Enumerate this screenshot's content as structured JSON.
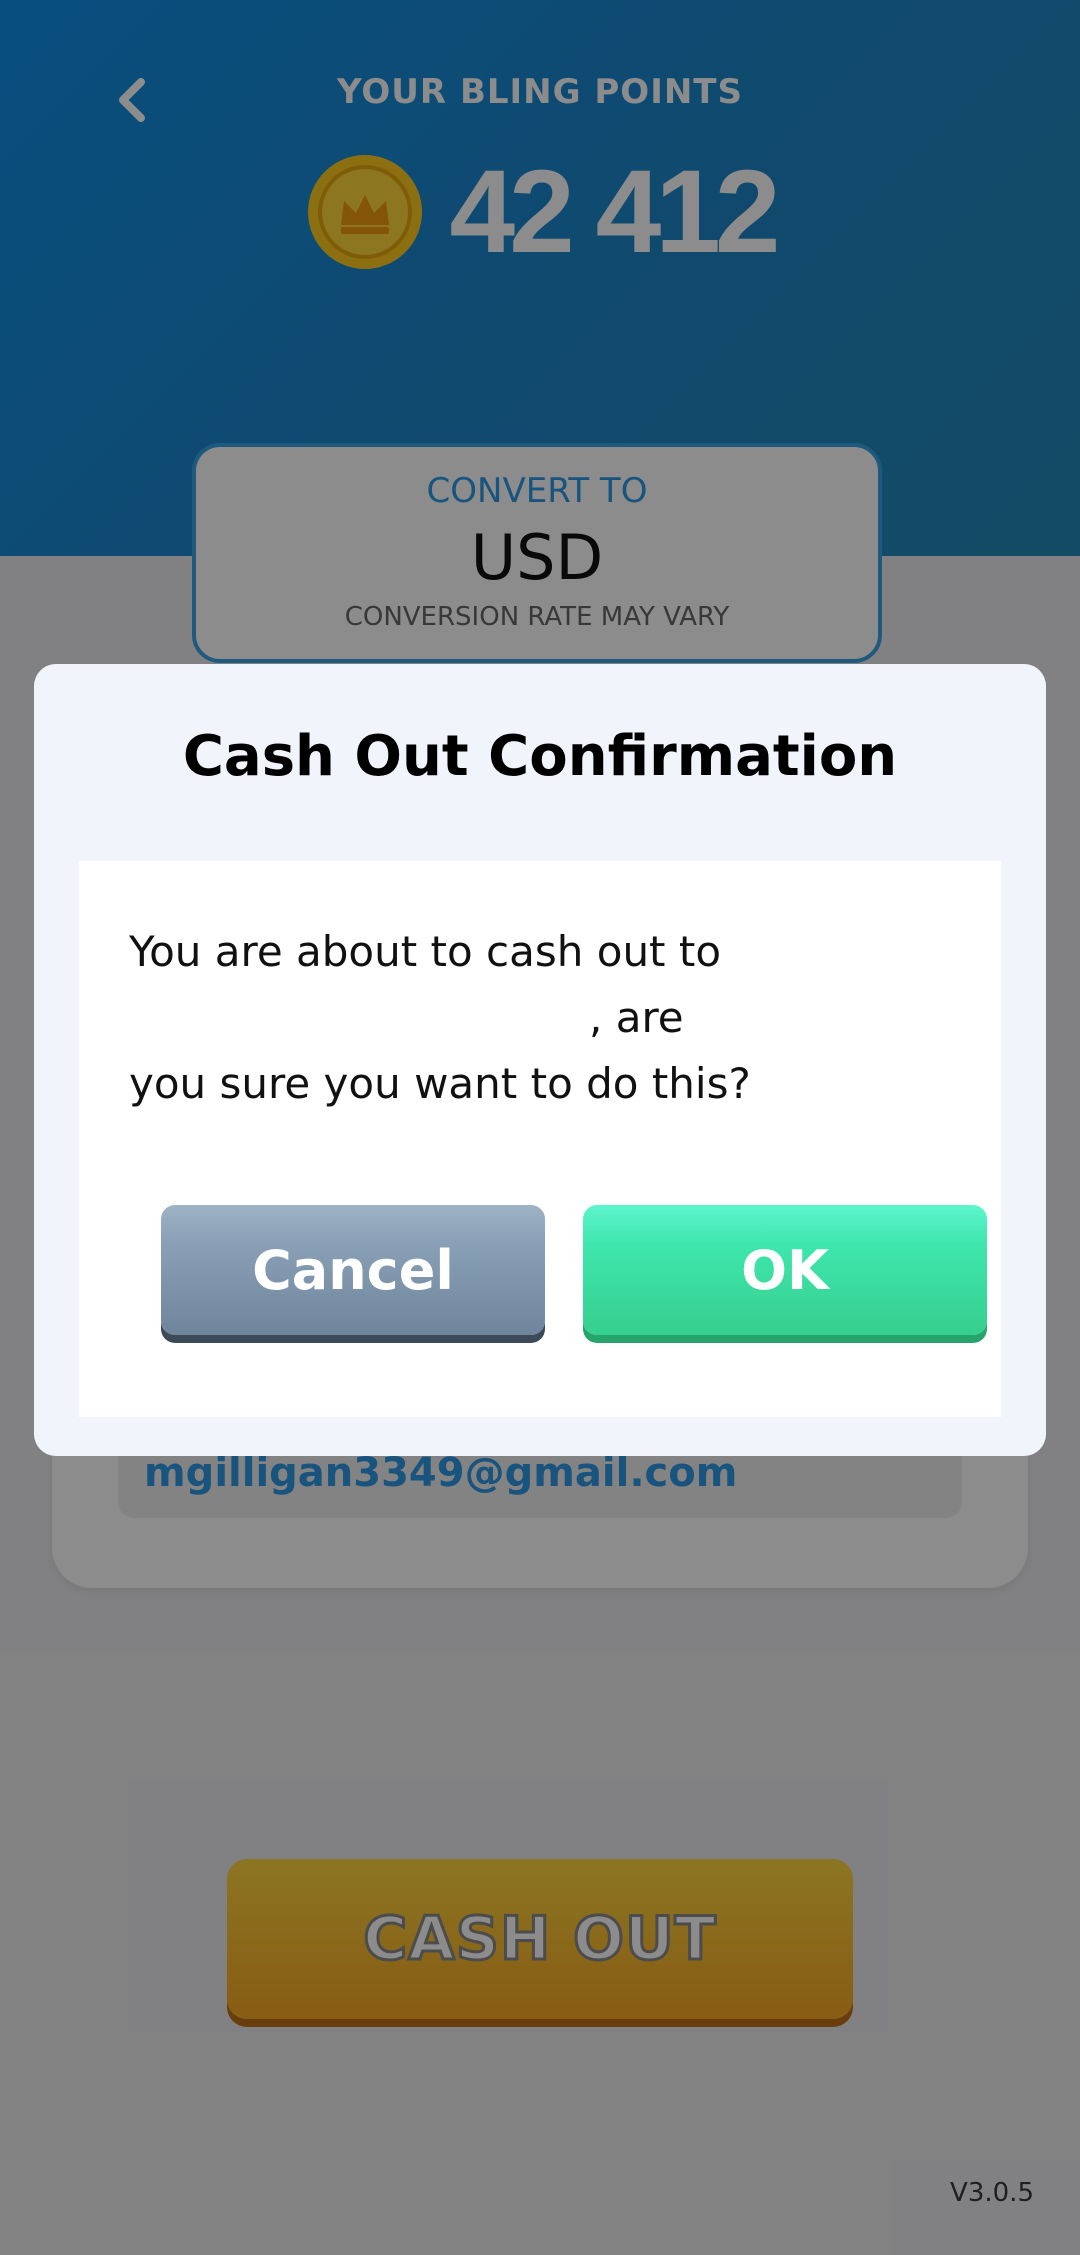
{
  "header": {
    "title": "YOUR BLING POINTS",
    "points": "42 412"
  },
  "convert": {
    "label": "CONVERT TO",
    "currency": "USD",
    "note": "CONVERSION RATE MAY VARY"
  },
  "account": {
    "email": "mgilligan3349@gmail.com"
  },
  "cashout": {
    "label": "CASH OUT"
  },
  "version": "V3.0.5",
  "dialog": {
    "title": "Cash Out Confirmation",
    "message_line1": "You are about to cash out to",
    "message_line2_suffix": ", are",
    "message_line3": "you sure you want to do this?",
    "cancel_label": "Cancel",
    "ok_label": "OK"
  },
  "colors": {
    "header_blue": "#1e86c8",
    "accent_blue": "#2c9ae3",
    "ok_green": "#3ee6ad",
    "cancel_slate": "#7d93aa",
    "cashout_gold": "#f7a824"
  },
  "icons": {
    "back": "chevron-left-icon",
    "coin": "crown-coin-icon"
  }
}
